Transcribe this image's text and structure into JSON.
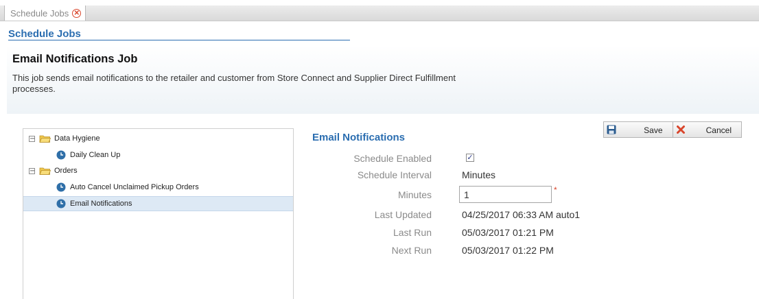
{
  "tab": {
    "label": "Schedule Jobs"
  },
  "section": {
    "title": "Schedule Jobs"
  },
  "job": {
    "title": "Email Notifications Job",
    "description_line1": "This job sends email notifications to the retailer and customer from Store Connect and Supplier Direct Fulfillment",
    "description_line2": "processes."
  },
  "tree": {
    "groups": [
      {
        "label": "Data Hygiene",
        "toggle": "−",
        "items": [
          "Daily Clean Up"
        ]
      },
      {
        "label": "Orders",
        "toggle": "−",
        "items": [
          "Auto Cancel Unclaimed Pickup Orders",
          "Email Notifications"
        ]
      }
    ],
    "selected": "Email Notifications"
  },
  "toolbar": {
    "save_label": "Save",
    "cancel_label": "Cancel"
  },
  "detail": {
    "title": "Email Notifications",
    "schedule_enabled_label": "Schedule Enabled",
    "schedule_enabled": true,
    "schedule_interval_label": "Schedule Interval",
    "schedule_interval_value": "Minutes",
    "minutes_label": "Minutes",
    "minutes_value": "1",
    "required_mark": "*",
    "last_updated_label": "Last Updated",
    "last_updated_value": "04/25/2017 06:33 AM auto1",
    "last_run_label": "Last Run",
    "last_run_value": "05/03/2017 01:21 PM",
    "next_run_label": "Next Run",
    "next_run_value": "05/03/2017 01:22 PM"
  },
  "colors": {
    "accent": "#2a6db0",
    "selected_row": "#dde9f5",
    "close": "#d9452b",
    "clock": "#2f6fa8",
    "folder": "#f2c94c"
  }
}
